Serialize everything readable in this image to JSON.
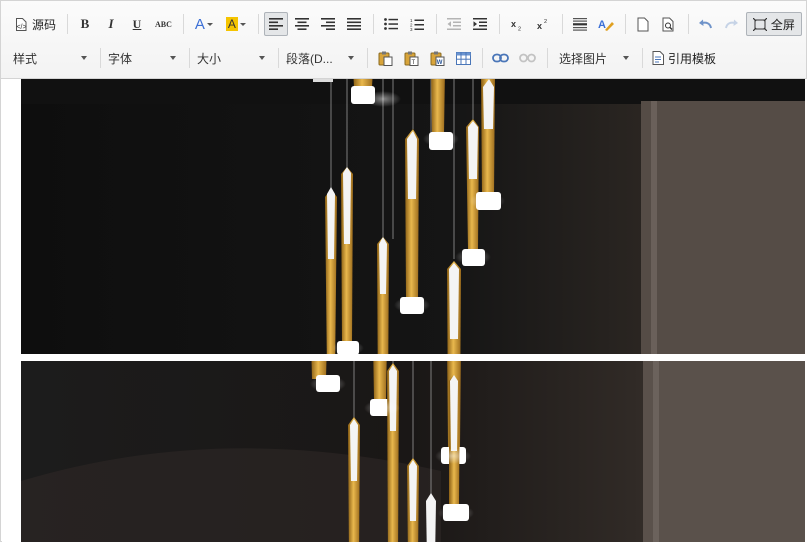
{
  "toolbar": {
    "source_label": "源码",
    "fullscreen_label": "全屏",
    "style_select": "样式",
    "font_select": "字体",
    "size_select": "大小",
    "paragraph_select": "段落(D...",
    "choose_image_label": "选择图片",
    "template_label": "引用模板",
    "bold_glyph": "B",
    "italic_glyph": "I",
    "underline_glyph": "U",
    "strike_glyph": "ABC",
    "font_color_glyph": "A",
    "bg_color_glyph": "A"
  },
  "colors": {
    "font_color_accent": "#3b6fd6",
    "bg_color_accent": "#f5c400",
    "photo_background": "#141414",
    "pendant_gold": "#c9962e"
  },
  "icons": [
    "source-icon",
    "bold-icon",
    "italic-icon",
    "underline-icon",
    "strikethrough-icon",
    "font-color-icon",
    "background-color-icon",
    "align-left-icon",
    "align-center-icon",
    "align-right-icon",
    "align-justify-icon",
    "bullet-list-icon",
    "numbered-list-icon",
    "outdent-icon",
    "indent-icon",
    "subscript-icon",
    "superscript-icon",
    "horizontal-rule-icon",
    "remove-format-icon",
    "new-page-icon",
    "preview-icon",
    "undo-icon",
    "redo-icon",
    "fullscreen-icon",
    "paste-icon",
    "paste-text-icon",
    "paste-word-icon",
    "table-icon",
    "link-icon",
    "unlink-icon",
    "template-icon"
  ]
}
